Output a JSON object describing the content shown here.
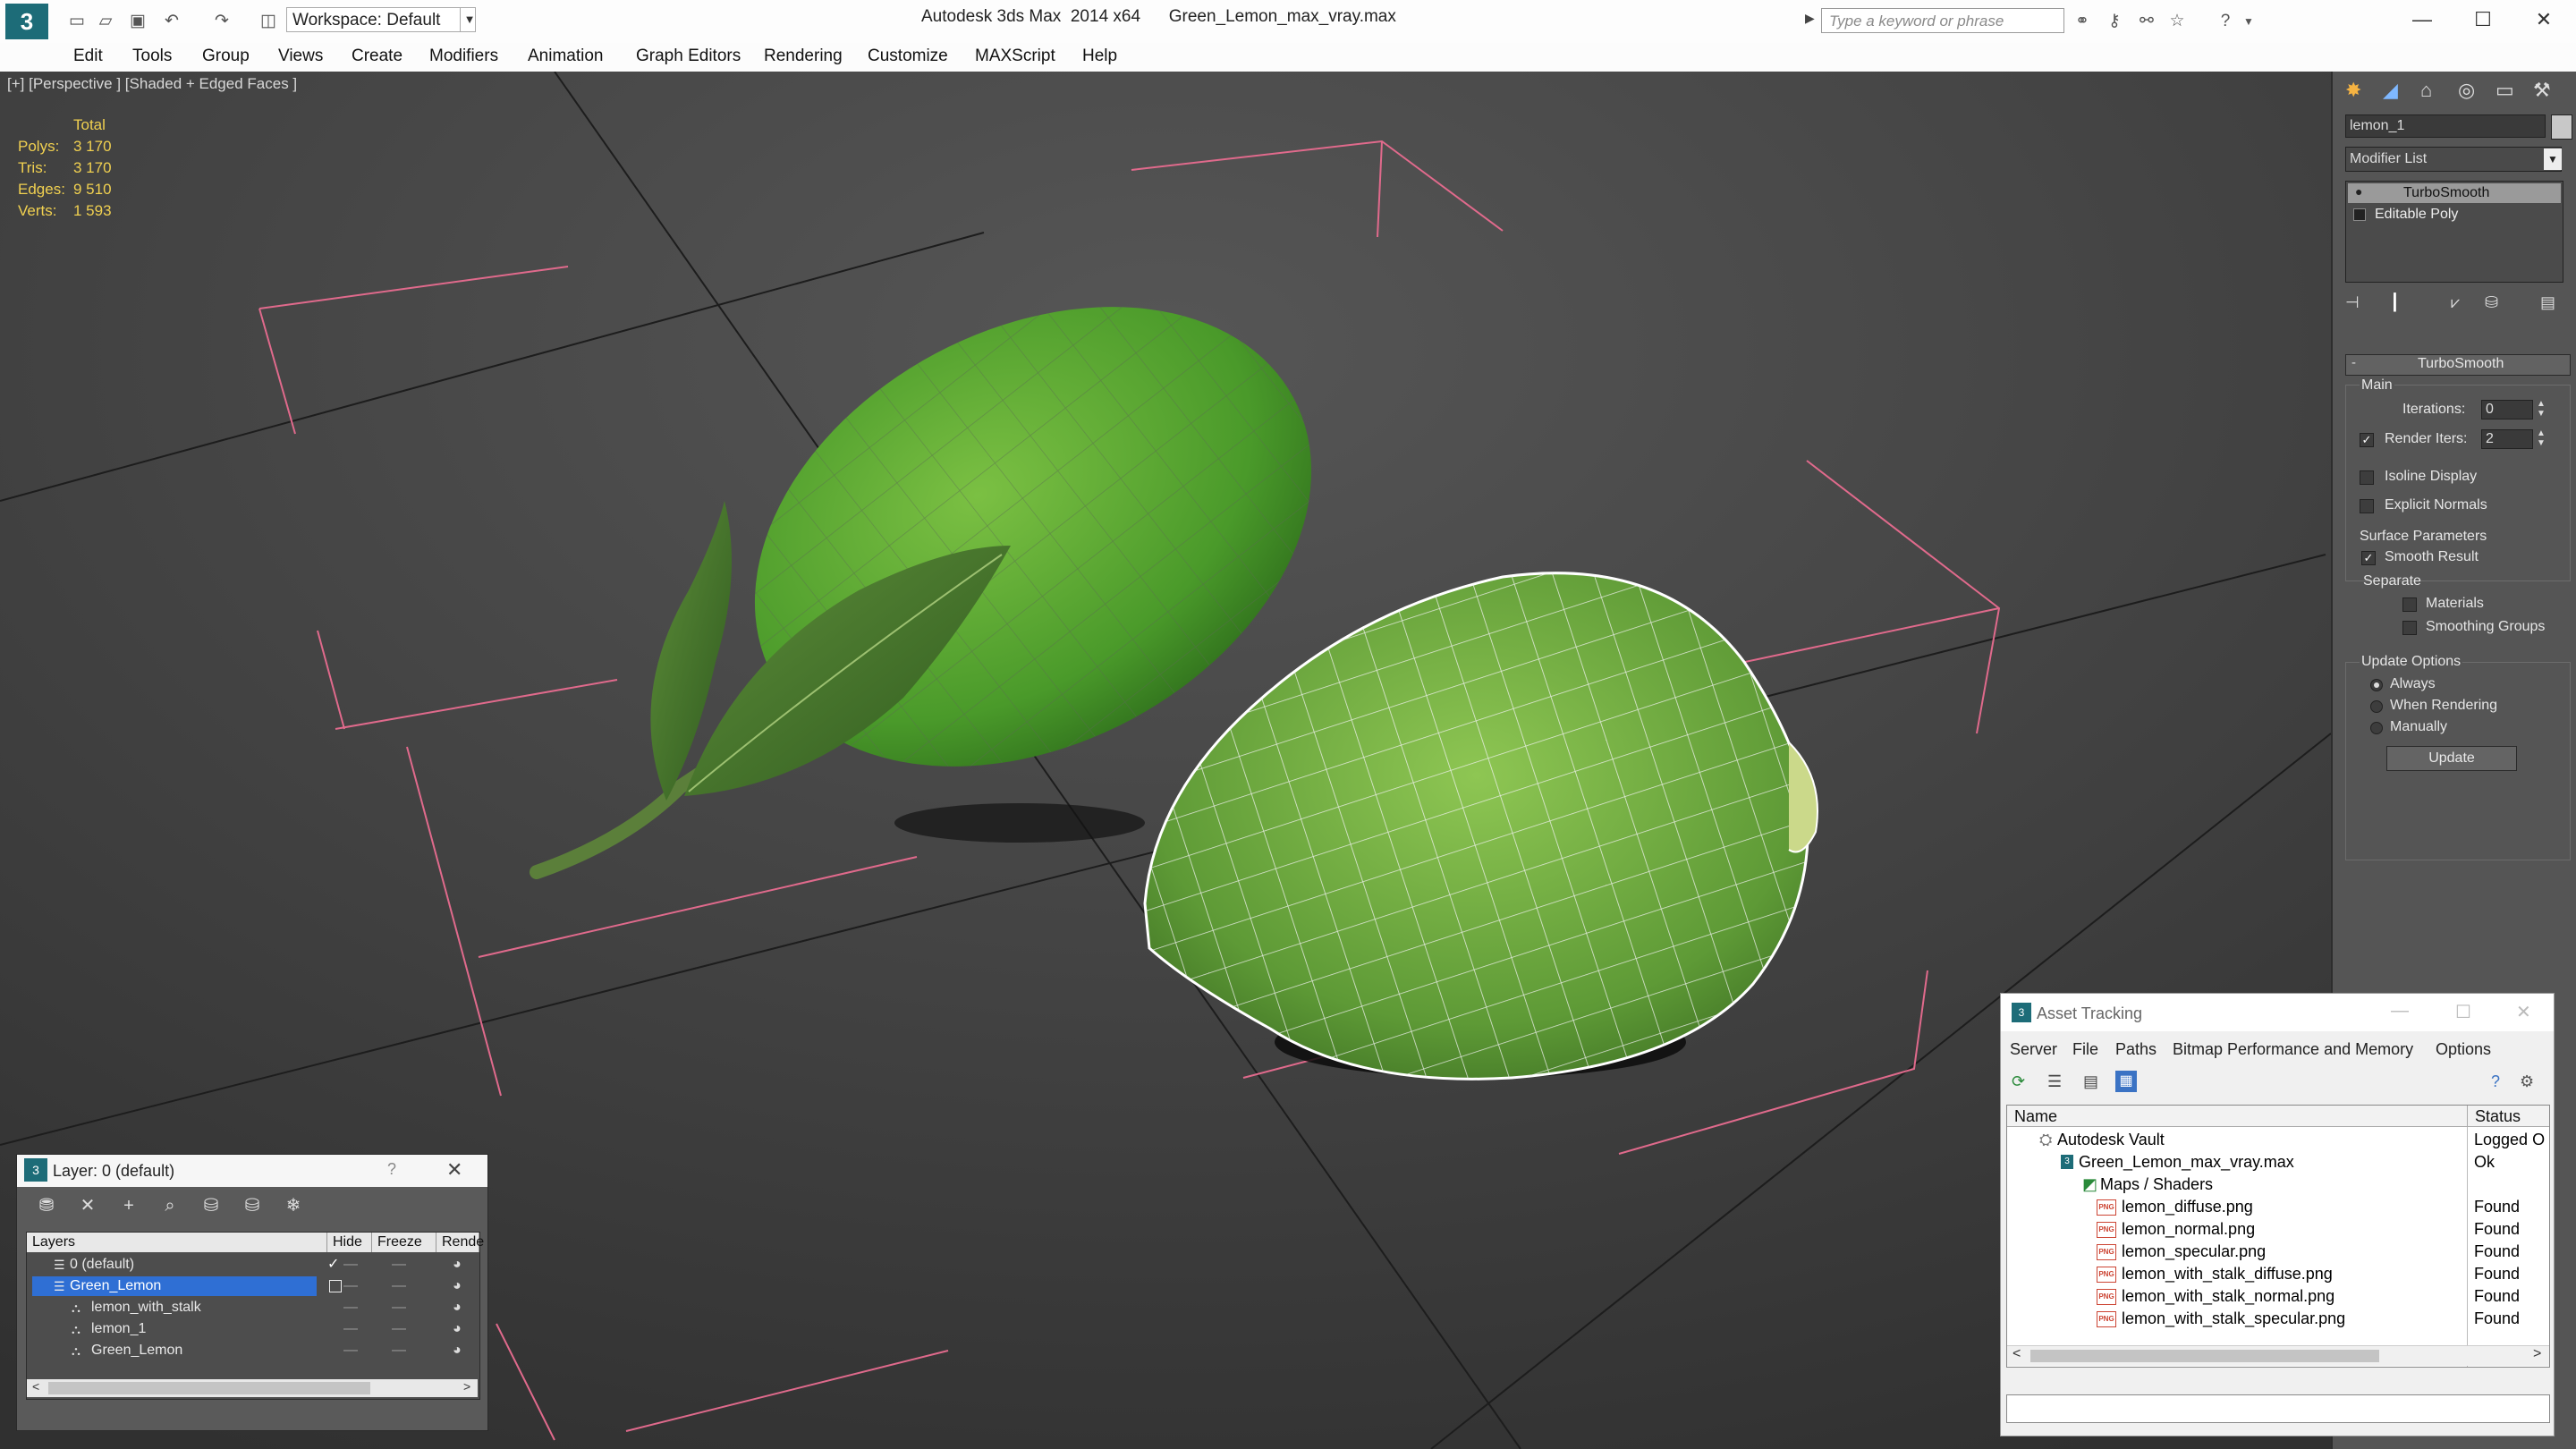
{
  "titlebar": {
    "title": "Autodesk 3ds Max  2014 x64      Green_Lemon_max_vray.max",
    "workspace": "Workspace: Default",
    "search_placeholder": "Type a keyword or phrase"
  },
  "menu": [
    "Edit",
    "Tools",
    "Group",
    "Views",
    "Create",
    "Modifiers",
    "Animation",
    "Graph Editors",
    "Rendering",
    "Customize",
    "MAXScript",
    "Help"
  ],
  "viewport": {
    "label": "[+] [Perspective ] [Shaded + Edged Faces ]",
    "stats_header": "Total",
    "stats": [
      {
        "label": "Polys:",
        "value": "3 170"
      },
      {
        "label": "Tris:",
        "value": "3 170"
      },
      {
        "label": "Edges:",
        "value": "9 510"
      },
      {
        "label": "Verts:",
        "value": "1 593"
      }
    ]
  },
  "command_panel": {
    "object_name": "lemon_1",
    "modifier_list": "Modifier List",
    "stack": [
      "TurboSmooth",
      "Editable Poly"
    ],
    "rollout_title": "TurboSmooth",
    "main_label": "Main",
    "iterations_label": "Iterations:",
    "iterations_value": "0",
    "render_iters_label": "Render Iters:",
    "render_iters_value": "2",
    "isoline_label": "Isoline Display",
    "explicit_normals_label": "Explicit Normals",
    "surface_params_label": "Surface Parameters",
    "smooth_result_label": "Smooth Result",
    "separate_label": "Separate",
    "materials_label": "Materials",
    "smoothing_groups_label": "Smoothing Groups",
    "update_options_label": "Update Options",
    "always_label": "Always",
    "when_rendering_label": "When Rendering",
    "manually_label": "Manually",
    "update_button": "Update"
  },
  "layer_window": {
    "title": "Layer: 0 (default)",
    "help": "?",
    "columns": [
      "Layers",
      "Hide",
      "Freeze",
      "Rende"
    ],
    "rows": [
      {
        "name": "0 (default)"
      },
      {
        "name": "Green_Lemon"
      },
      {
        "name": "lemon_with_stalk"
      },
      {
        "name": "lemon_1"
      },
      {
        "name": "Green_Lemon"
      }
    ]
  },
  "asset_tracking": {
    "title": "Asset Tracking",
    "menu": [
      "Server",
      "File",
      "Paths",
      "Bitmap Performance and Memory",
      "Options"
    ],
    "columns": [
      "Name",
      "Status"
    ],
    "rows": [
      {
        "name": "Autodesk Vault",
        "status": "Logged O"
      },
      {
        "name": "Green_Lemon_max_vray.max",
        "status": "Ok"
      },
      {
        "name": "Maps / Shaders",
        "status": ""
      },
      {
        "name": "lemon_diffuse.png",
        "status": "Found"
      },
      {
        "name": "lemon_normal.png",
        "status": "Found"
      },
      {
        "name": "lemon_specular.png",
        "status": "Found"
      },
      {
        "name": "lemon_with_stalk_diffuse.png",
        "status": "Found"
      },
      {
        "name": "lemon_with_stalk_normal.png",
        "status": "Found"
      },
      {
        "name": "lemon_with_stalk_specular.png",
        "status": "Found"
      }
    ]
  },
  "colors": {
    "accent": "#f0d050",
    "selection": "#2f6fd4",
    "bracket": "#e06a8c"
  }
}
